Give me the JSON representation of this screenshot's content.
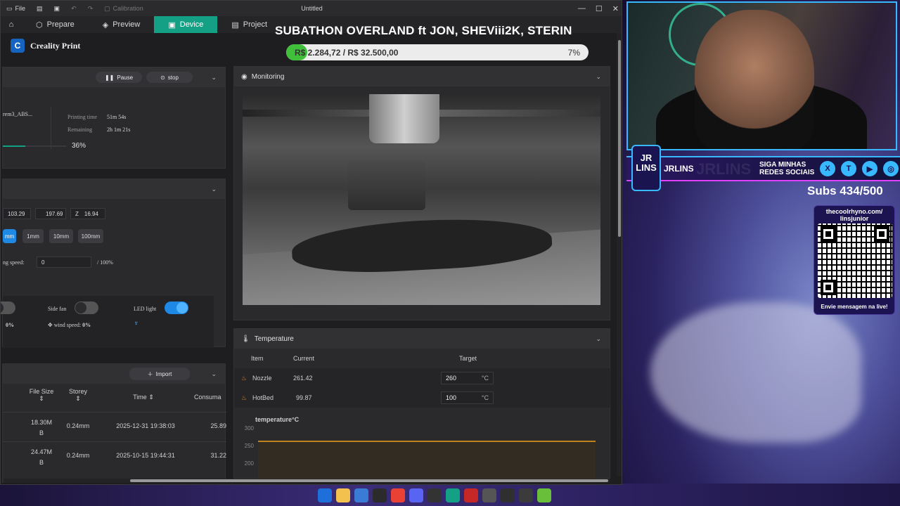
{
  "titlebar": {
    "file": "File",
    "calibration": "Calibration",
    "title": "Untitled"
  },
  "nav": {
    "tabs": [
      {
        "label": "Prepare"
      },
      {
        "label": "Preview"
      },
      {
        "label": "Device"
      },
      {
        "label": "Project"
      }
    ]
  },
  "brand": {
    "name": "Creality Print"
  },
  "subathon": {
    "title": "SUBATHON OVERLAND ft JON, SHEViii2K, STERIN",
    "amount": "R$ 2.284,72 / R$ 32.500,00",
    "percent": "7%",
    "progress": 0.07
  },
  "print_panel": {
    "pause": "Pause",
    "stop": "stop",
    "filename": "rem3_ABS...",
    "printing_time_label": "Printing time",
    "printing_time": "51m 54s",
    "remaining_label": "Remaining",
    "remaining": "2h 1m 21s",
    "progress_text": "36%",
    "progress": 0.36
  },
  "control_panel": {
    "x": "103.29",
    "y": "197.69",
    "z_label": "Z",
    "z": "16.94",
    "steps": [
      "mm",
      "1mm",
      "10mm",
      "100mm"
    ],
    "speed_label": "ng speed:",
    "speed_value": "0",
    "speed_max": "/ 100%",
    "fan_pct": "0%",
    "side_fan_label": "Side fan",
    "wind_label": "wind speed:",
    "wind_value": "0%",
    "led_label": "LED light"
  },
  "files": {
    "import": "Import",
    "headers": [
      "File Size",
      "Storey",
      "Time",
      "Consuma"
    ],
    "rows": [
      {
        "size": "18.30M\nB",
        "storey": "0.24mm",
        "time": "2025-12-31 19:38:03",
        "cons": "25.89"
      },
      {
        "size": "24.47M\nB",
        "storey": "0.24mm",
        "time": "2025-10-15 19:44:31",
        "cons": "31.22"
      }
    ]
  },
  "monitoring": {
    "title": "Monitoring"
  },
  "temperature": {
    "title": "Temperature",
    "headers": {
      "item": "Item",
      "current": "Current",
      "target": "Target"
    },
    "rows": [
      {
        "item": "Nozzle",
        "current": "261.42",
        "target": "260",
        "unit": "°C"
      },
      {
        "item": "HotBed",
        "current": "99.87",
        "target": "100",
        "unit": "°C"
      }
    ],
    "chart_title": "temperature°C",
    "ticks": [
      "300",
      "250",
      "200"
    ]
  },
  "chart_data": {
    "type": "line",
    "title": "temperature°C",
    "xlabel": "",
    "ylabel": "",
    "ylim": [
      190,
      300
    ],
    "series": [
      {
        "values": [
          260,
          260,
          260,
          260,
          260,
          260,
          260,
          260
        ]
      }
    ]
  },
  "overlay": {
    "jr": "JR\nLINS",
    "name": "JRLINS",
    "siga": "SIGA MINHAS\nREDES SOCIAIS",
    "socials": [
      "X",
      "T",
      "▶",
      "◎"
    ],
    "subs": "Subs 434/500",
    "qr_url": "thecoolrhyno.com/\nlinsjunior",
    "qr_msg": "Envie mensagem na live!"
  },
  "colors": {
    "accent": "#14a085",
    "blue": "#1e88e5",
    "progress_green": "#3fbf3a"
  }
}
